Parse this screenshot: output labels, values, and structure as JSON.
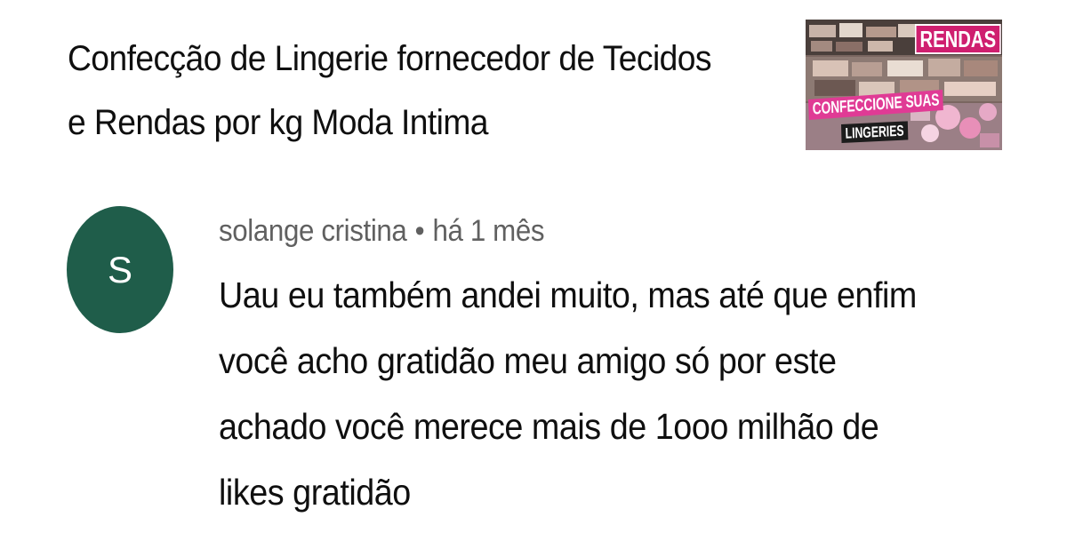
{
  "video": {
    "title": "Confecção de Lingerie fornecedor de Tecidos e Rendas por kg Moda Intima",
    "thumbnail": {
      "badge_top": "RENDAS",
      "badge_middle": "CONFECCIONE SUAS",
      "badge_bottom": "LINGERIES"
    }
  },
  "comment": {
    "avatar_letter": "S",
    "avatar_color": "#1f5d4a",
    "author": "solange cristina",
    "separator": "•",
    "time": "há 1 mês",
    "text": "Uau eu também andei muito, mas até que enfim você acho gratidão meu amigo só por este achado você merece mais de 1ooo milhão de likes gratidão"
  }
}
